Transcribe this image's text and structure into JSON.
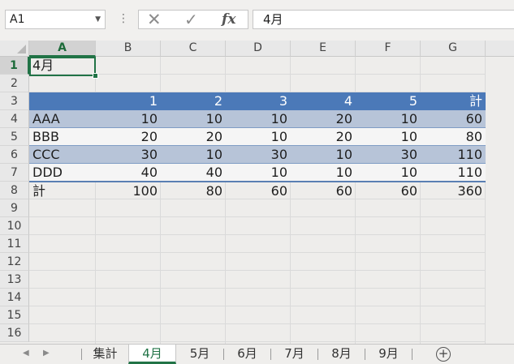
{
  "formula_bar": {
    "name_box": "A1",
    "cancel_icon": "✕",
    "enter_icon": "✓",
    "fx_icon": "fx",
    "formula": "4月"
  },
  "columns": [
    "A",
    "B",
    "C",
    "D",
    "E",
    "F",
    "G"
  ],
  "rows": [
    "1",
    "2",
    "3",
    "4",
    "5",
    "6",
    "7",
    "8",
    "9",
    "10",
    "11",
    "12",
    "13",
    "14",
    "15",
    "16"
  ],
  "cells": {
    "A1": "4月",
    "header": [
      "",
      "1",
      "2",
      "3",
      "4",
      "5",
      "計"
    ],
    "data": [
      [
        "AAA",
        "10",
        "10",
        "10",
        "20",
        "10",
        "60"
      ],
      [
        "BBB",
        "20",
        "20",
        "10",
        "20",
        "10",
        "80"
      ],
      [
        "CCC",
        "30",
        "10",
        "30",
        "10",
        "30",
        "110"
      ],
      [
        "DDD",
        "40",
        "40",
        "10",
        "10",
        "10",
        "110"
      ]
    ],
    "total": [
      "計",
      "100",
      "80",
      "60",
      "60",
      "60",
      "360"
    ]
  },
  "sheet_tabs": [
    "集計",
    "4月",
    "5月",
    "6月",
    "7月",
    "8月",
    "9月"
  ],
  "active_sheet": "4月",
  "colors": {
    "table_header": "#4b79b8",
    "band_row": "#b7c4d8",
    "accent_green": "#217346"
  }
}
